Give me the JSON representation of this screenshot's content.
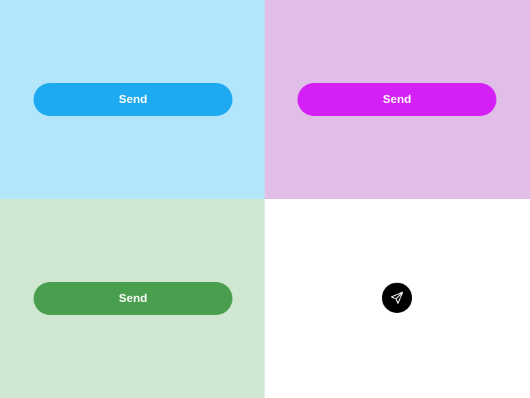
{
  "panels": {
    "blue": {
      "background": "#b3e5fb",
      "button_color": "#1eaaf0",
      "button_label": "Send"
    },
    "purple": {
      "background": "#e1bee7",
      "button_color": "#d41ff5",
      "button_label": "Send"
    },
    "green": {
      "background": "#d0e8d1",
      "button_color": "#4a9f4f",
      "button_label": "Send"
    },
    "white": {
      "background": "#ffffff",
      "icon_button_color": "#000000",
      "icon": "paper-plane-icon"
    }
  }
}
